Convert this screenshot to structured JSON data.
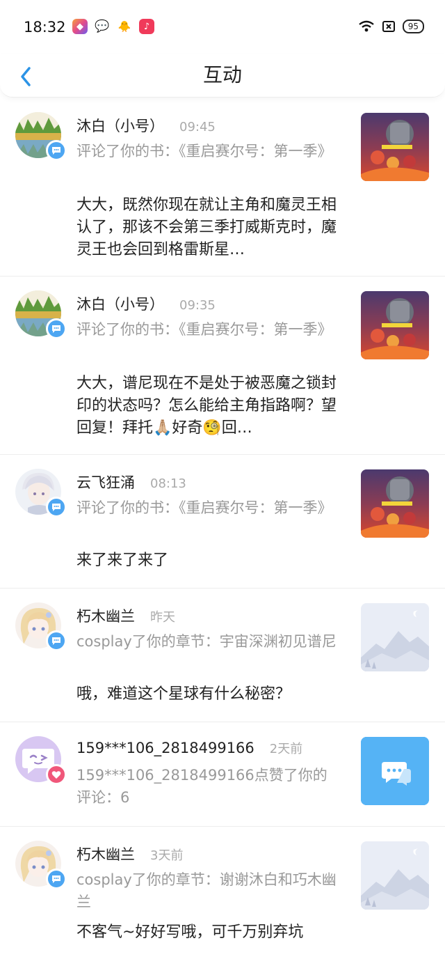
{
  "status_bar": {
    "time": "18:32",
    "battery": "95"
  },
  "nav": {
    "title": "互动"
  },
  "items": [
    {
      "user": "沐白（小号）",
      "time": "09:45",
      "action": "评论了你的书：《重启赛尔号：第一季》",
      "content": "大大，既然你现在就让主角和魔灵王相认了，那该不会第三季打威斯克时，魔灵王也会回到格雷斯星…",
      "badge": "comment",
      "thumb": "book-cover",
      "avatar": "landscape"
    },
    {
      "user": "沐白（小号）",
      "time": "09:35",
      "action": "评论了你的书：《重启赛尔号：第一季》",
      "content": "大大，谱尼现在不是处于被恶魔之锁封印的状态吗？怎么能给主角指路啊？望回复！拜托🙏🏼好奇🧐回…",
      "badge": "comment",
      "thumb": "book-cover",
      "avatar": "landscape"
    },
    {
      "user": "云飞狂涌",
      "time": "08:13",
      "action": "评论了你的书：《重启赛尔号：第一季》",
      "content": "来了来了来了",
      "badge": "comment",
      "thumb": "book-cover",
      "avatar": "anime-boy"
    },
    {
      "user": "朽木幽兰",
      "time": "昨天",
      "action": "cosplay了你的章节：宇宙深渊初见谱尼",
      "content": "哦，难道这个星球有什么秘密？",
      "badge": "comment",
      "thumb": "placeholder",
      "avatar": "anime-girl"
    },
    {
      "user": "159***106_2818499166",
      "time": "2天前",
      "action": "159***106_2818499166点赞了你的评论：6",
      "content": "",
      "badge": "like",
      "thumb": "comment-icon",
      "avatar": "chat-face"
    },
    {
      "user": "朽木幽兰",
      "time": "3天前",
      "action": "cosplay了你的章节：谢谢沐白和巧木幽兰",
      "content": "不客气~好好写哦，可千万别弃坑",
      "badge": "comment",
      "thumb": "placeholder",
      "avatar": "anime-girl"
    }
  ],
  "colors": {
    "accent": "#2b93e6",
    "badge_comment": "#4da6f2",
    "badge_like": "#f0577a"
  }
}
